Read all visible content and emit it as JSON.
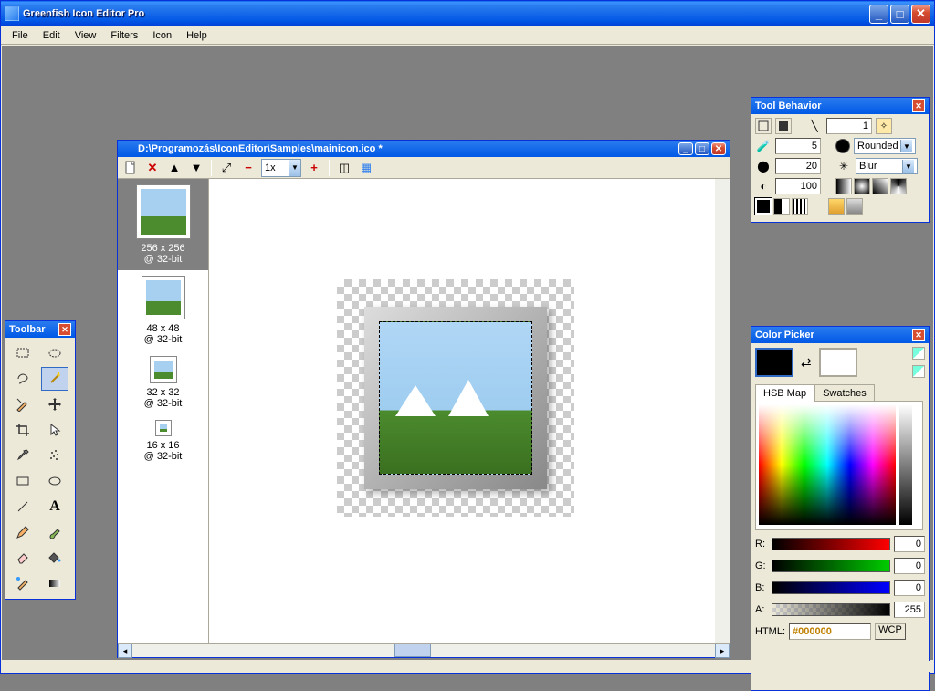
{
  "app": {
    "title": "Greenfish Icon Editor Pro"
  },
  "menu": [
    "File",
    "Edit",
    "View",
    "Filters",
    "Icon",
    "Help"
  ],
  "toolbar_panel": {
    "title": "Toolbar",
    "tools": [
      "rect-select",
      "ellipse-select",
      "lasso",
      "wand",
      "pencil-line",
      "move",
      "crop",
      "arrow-select",
      "eyedropper",
      "spray",
      "rectangle",
      "ellipse",
      "line",
      "text",
      "pencil",
      "brush",
      "eraser",
      "bucket",
      "recolor",
      "gradient"
    ],
    "active": "wand"
  },
  "tool_behavior": {
    "title": "Tool Behavior",
    "line_width": "1",
    "tolerance": "5",
    "shape_mode": "Rounded",
    "brush_size": "20",
    "effect": "Blur",
    "opacity": "100"
  },
  "color_picker": {
    "title": "Color Picker",
    "fg": "#000000",
    "bg": "#ffffff",
    "tabs": [
      "HSB Map",
      "Swatches"
    ],
    "active_tab": "HSB Map",
    "r_label": "R:",
    "g_label": "G:",
    "b_label": "B:",
    "a_label": "A:",
    "r": "0",
    "g": "0",
    "b": "0",
    "a": "255",
    "html_label": "HTML:",
    "html": "#000000",
    "wcp": "WCP"
  },
  "document": {
    "title": "D:\\Programozás\\IconEditor\\Samples\\mainicon.ico *",
    "zoom": "1x",
    "pages": [
      {
        "size": "256 x 256",
        "depth": "@ 32-bit",
        "selected": true
      },
      {
        "size": "48 x 48",
        "depth": "@ 32-bit",
        "selected": false
      },
      {
        "size": "32 x 32",
        "depth": "@ 32-bit",
        "selected": false
      },
      {
        "size": "16 x 16",
        "depth": "@ 32-bit",
        "selected": false
      }
    ]
  }
}
